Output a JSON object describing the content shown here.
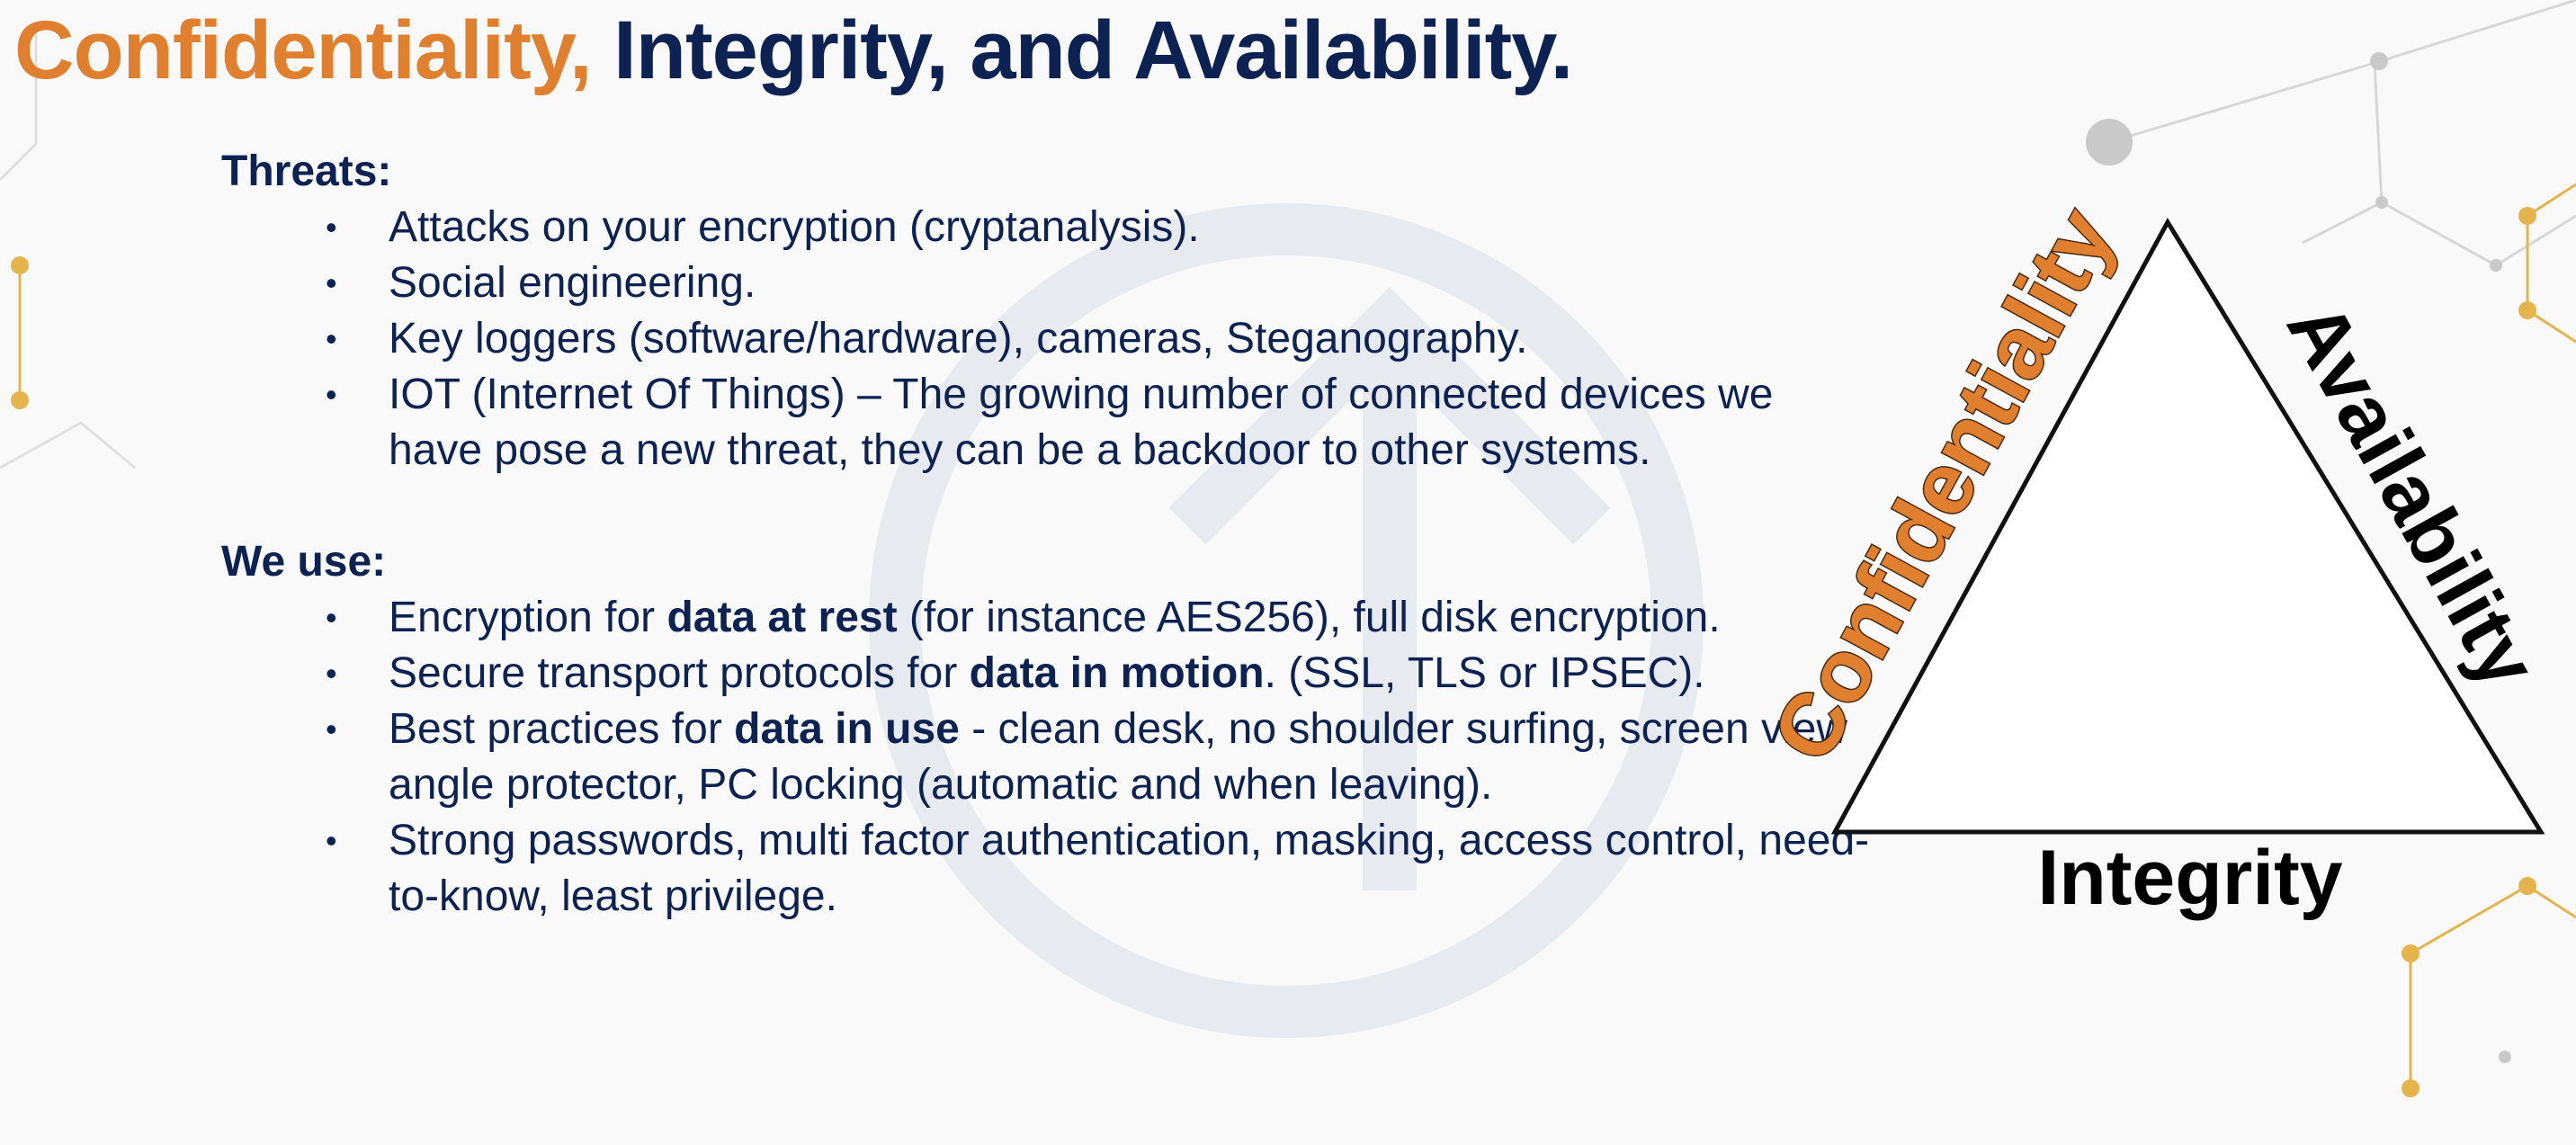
{
  "title": {
    "accent": "Confidentiality,",
    "rest": " Integrity, and Availability."
  },
  "threats": {
    "heading": "Threats:",
    "items": [
      "Attacks on your encryption (cryptanalysis).",
      "Social engineering.",
      "Key loggers (software/hardware), cameras, Steganography.",
      "IOT (Internet Of Things) – The growing number of connected devices we have pose a new threat, they can be a backdoor to other systems."
    ]
  },
  "we_use": {
    "heading": "We use:",
    "items": [
      {
        "pre": "Encryption for ",
        "bold": "data at rest",
        "post": " (for instance AES256), full disk encryption."
      },
      {
        "pre": "Secure transport protocols for ",
        "bold": "data in motion",
        "post": ". (SSL, TLS or IPSEC)."
      },
      {
        "pre": "Best practices for ",
        "bold": "data in use",
        "post": " - clean desk, no shoulder surfing, screen view angle protector, PC locking (automatic and when leaving)."
      },
      {
        "pre": "Strong passwords, multi factor authentication, masking, access control, need-to-know, least privilege.",
        "bold": "",
        "post": ""
      }
    ]
  },
  "bullet_glyph": "•",
  "triangle": {
    "left_label": "Confidentiality",
    "right_label": "Availability",
    "bottom_label": "Integrity",
    "left_color": "#e07f2d",
    "right_color": "#000000",
    "bottom_color": "#000000"
  },
  "colors": {
    "navy": "#0c2252",
    "orange": "#e07f2d",
    "background": "#f9f9fa"
  }
}
